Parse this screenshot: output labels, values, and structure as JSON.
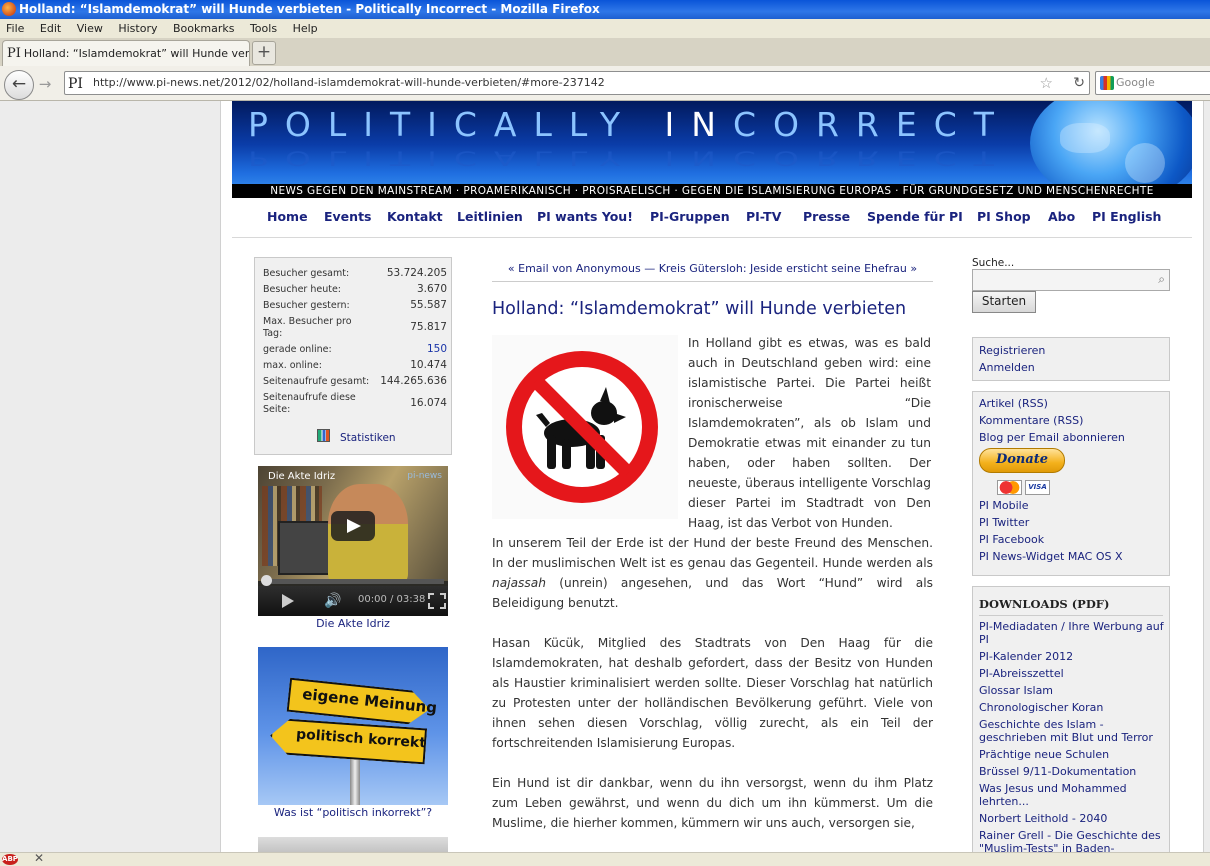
{
  "window": {
    "title": "Holland: “Islamdemokrat” will Hunde verbieten - Politically Incorrect - Mozilla Firefox"
  },
  "menu": [
    "File",
    "Edit",
    "View",
    "History",
    "Bookmarks",
    "Tools",
    "Help"
  ],
  "tab": {
    "favicon": "PI",
    "label": "Holland: “Islamdemokrat” will Hunde verbiete...",
    "new_tab": "+"
  },
  "navbar": {
    "back_icon": "←",
    "forward_icon": "→",
    "favicon": "PI",
    "url": "http://www.pi-news.net/2012/02/holland-islamdemokrat-will-hunde-verbieten/#more-237142",
    "bookmark_star": "☆",
    "reload_icon": "↻",
    "search_placeholder": "Google"
  },
  "site": {
    "logo_left": "POLITICALLY ",
    "logo_in": "IN",
    "logo_right": "CORRECT",
    "tagline": "NEWS GEGEN DEN MAINSTREAM · PROAMERIKANISCH · PROISRAELISCH · GEGEN DIE ISLAMISIERUNG EUROPAS · FÜR GRUNDGESETZ UND MENSCHENRECHTE",
    "nav": [
      "Home",
      "Events",
      "Kontakt",
      "Leitlinien",
      "PI wants You!",
      "PI-Gruppen",
      "PI-TV",
      "Presse",
      "Spende für PI",
      "PI Shop",
      "Abo",
      "PI English"
    ]
  },
  "stats": {
    "rows": [
      {
        "label": "Besucher gesamt:",
        "value": "53.724.205"
      },
      {
        "label": "Besucher heute:",
        "value": "3.670"
      },
      {
        "label": "Besucher gestern:",
        "value": "55.587"
      },
      {
        "label": "Max. Besucher pro Tag:",
        "value": "75.817"
      },
      {
        "label": "gerade online:",
        "value": "150"
      },
      {
        "label": "max. online:",
        "value": "10.474"
      },
      {
        "label": "Seitenaufrufe gesamt:",
        "value": "144.265.636"
      },
      {
        "label": "Seitenaufrufe diese Seite:",
        "value": "16.074"
      }
    ],
    "link": "Statistiken"
  },
  "video": {
    "title": "Die Akte Idriz",
    "brand": "pi-news",
    "time": "00:00 / 03:38",
    "caption": "Die Akte Idriz"
  },
  "sign_image": {
    "top_sign": "eigene Meinung",
    "bottom_sign": "politisch korrekt",
    "caption": "Was ist “politisch inkorrekt”?"
  },
  "post": {
    "nav": "« Email von Anonymous — Kreis Gütersloh: Jeside ersticht seine Ehefrau »",
    "title": "Holland: “Islamdemokrat” will Hunde verbieten",
    "p1": "In Holland gibt es etwas, was es bald auch in Deutschland geben wird: eine islamistische Partei. Die Partei heißt ironischerweise “Die Islamdemokraten”, als ob Islam und Demokratie etwas mit einander zu tun haben, oder haben sollten. Der neueste, überaus intelligente Vorschlag dieser Partei im Stadtradt von Den Haag, ist das Verbot von Hunden.",
    "p2_before": "In unserem Teil der Erde ist der Hund der beste Freund des Menschen. In der muslimischen Welt ist es genau das Gegenteil. Hunde werden als ",
    "p2_em": "najassah",
    "p2_after": " (unrein) angesehen, und das Wort “Hund” wird als Beleidigung benutzt.",
    "p3": "Hasan Kücük, Mitglied des Stadtrats von Den Haag für die Islamdemokraten, hat deshalb gefordert, dass der Besitz von Hunden als Haustier kriminalisiert werden sollte. Dieser Vorschlag hat natürlich zu Protesten unter der holländischen Bevölkerung geführt. Viele von ihnen sehen diesen Vorschlag, völlig zurecht, als ein Teil der fortschreitenden Islamisierung Europas.",
    "p4": "Ein Hund ist dir dankbar, wenn du ihn versorgst, wenn du ihm Platz zum Leben gewährst, und wenn du dich um ihn kümmerst. Um die Muslime, die hierher kommen, kümmern wir uns auch, versorgen sie,"
  },
  "sidebar": {
    "search_label": "Suche...",
    "search_button": "Starten",
    "account": [
      "Registrieren",
      "Anmelden"
    ],
    "feeds": [
      "Artikel (RSS)",
      "Kommentare (RSS)",
      "Blog per Email abonnieren"
    ],
    "donate": "Donate",
    "cards": [
      "",
      "VISA"
    ],
    "social": [
      "PI Mobile",
      "PI Twitter",
      "PI Facebook",
      "PI News-Widget MAC OS X"
    ],
    "downloads_title": "DOWNLOADS (PDF)",
    "downloads": [
      "PI-Mediadaten / Ihre Werbung auf PI",
      "PI-Kalender 2012",
      "PI-Abreisszettel",
      "Glossar Islam",
      "Chronologischer Koran",
      "Geschichte des Islam - geschrieben mit Blut und Terror",
      "Prächtige neue Schulen",
      "Brüssel 9/11-Dokumentation",
      "Was Jesus und Mohammed lehrten...",
      "Norbert Leithold - 2040",
      "Rainer Grell - Die Geschichte des \"Muslim-Tests\" in Baden-"
    ]
  },
  "status": {
    "abp": "ABP",
    "close": "✕"
  }
}
